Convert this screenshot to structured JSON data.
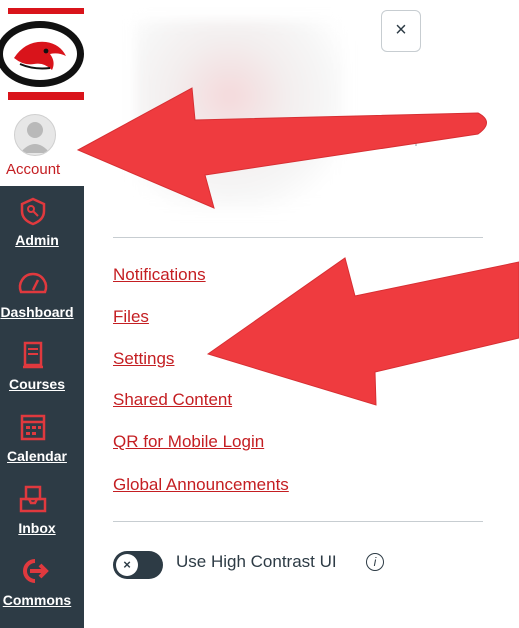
{
  "nav": {
    "account_label": "Account",
    "items": [
      {
        "label": "Admin",
        "icon": "shield-key-icon"
      },
      {
        "label": "Dashboard",
        "icon": "speedometer-icon"
      },
      {
        "label": "Courses",
        "icon": "book-icon"
      },
      {
        "label": "Calendar",
        "icon": "calendar-icon"
      },
      {
        "label": "Inbox",
        "icon": "inbox-icon"
      },
      {
        "label": "Commons",
        "icon": "commons-arrow-icon"
      }
    ]
  },
  "tray": {
    "close_icon": "×",
    "links": [
      "Notifications",
      "Files",
      "Settings",
      "Shared Content",
      "QR for Mobile Login",
      "Global Announcements"
    ],
    "toggle_label": "Use High Contrast UI",
    "toggle_knob": "×",
    "info_glyph": "i"
  },
  "colors": {
    "brand_red": "#c41e22",
    "nav_dark": "#2d3b45",
    "arrow_red": "#ef3b3f"
  }
}
